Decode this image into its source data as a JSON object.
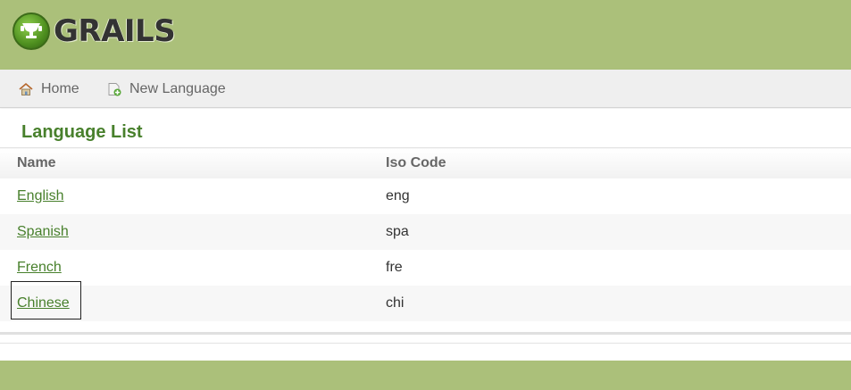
{
  "header": {
    "logo_text": "GRAILS",
    "bg_color": "#abc07a"
  },
  "nav": {
    "items": [
      {
        "label": "Home",
        "icon": "house-icon"
      },
      {
        "label": "New Language",
        "icon": "new-document-icon"
      }
    ]
  },
  "main": {
    "title": "Language List",
    "columns": [
      "Name",
      "Iso Code"
    ],
    "rows": [
      {
        "name": "English",
        "iso": "eng"
      },
      {
        "name": "Spanish",
        "iso": "spa"
      },
      {
        "name": "French",
        "iso": "fre"
      },
      {
        "name": "Chinese",
        "iso": "chi"
      }
    ],
    "link_color": "#48802c"
  }
}
